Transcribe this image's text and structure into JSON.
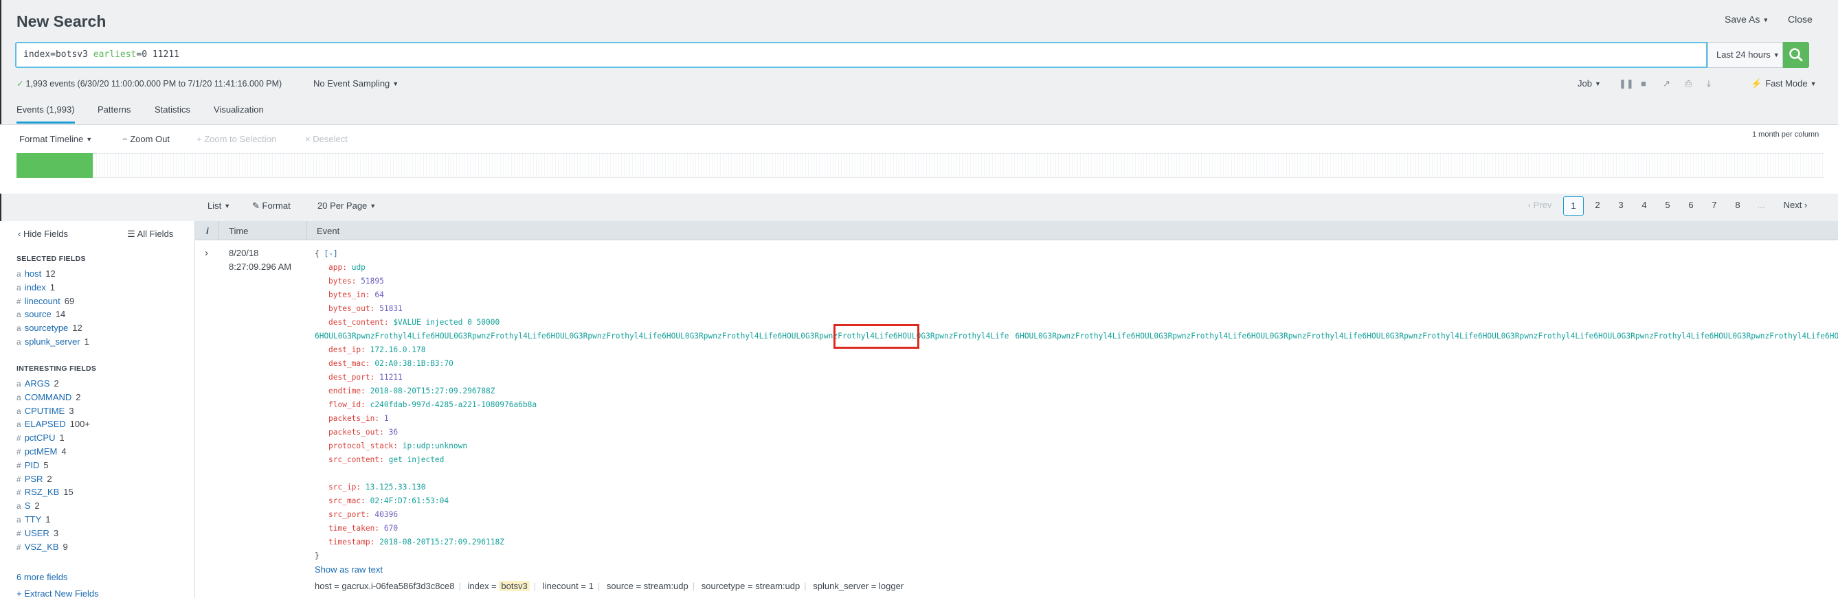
{
  "header": {
    "title": "New Search",
    "save_as": "Save As",
    "close": "Close"
  },
  "search": {
    "query_part1": "index=botsv3 ",
    "query_kw": "earliest",
    "query_part2": "=0 11211",
    "time_range": "Last 24 hours"
  },
  "status": {
    "events_summary": "1,993 events (6/30/20 11:00:00.000 PM to 7/1/20 11:41:16.000 PM)",
    "sampling": "No Event Sampling",
    "job": "Job",
    "mode": "Fast Mode"
  },
  "tabs": [
    {
      "label": "Events (1,993)"
    },
    {
      "label": "Patterns"
    },
    {
      "label": "Statistics"
    },
    {
      "label": "Visualization"
    }
  ],
  "timeline": {
    "format": "Format Timeline",
    "zoom_out": "Zoom Out",
    "zoom_selection": "Zoom to Selection",
    "deselect": "Deselect",
    "scale": "1 month per column"
  },
  "results": {
    "list": "List",
    "format": "Format",
    "per_page": "20 Per Page",
    "prev": "Prev",
    "pages": [
      "1",
      "2",
      "3",
      "4",
      "5",
      "6",
      "7",
      "8"
    ],
    "ellipsis": "...",
    "next": "Next"
  },
  "sidebar": {
    "hide_fields": "Hide Fields",
    "all_fields": "All Fields",
    "selected_heading": "SELECTED FIELDS",
    "selected": [
      {
        "type": "a",
        "name": "host",
        "count": "12"
      },
      {
        "type": "a",
        "name": "index",
        "count": "1"
      },
      {
        "type": "#",
        "name": "linecount",
        "count": "69"
      },
      {
        "type": "a",
        "name": "source",
        "count": "14"
      },
      {
        "type": "a",
        "name": "sourcetype",
        "count": "12"
      },
      {
        "type": "a",
        "name": "splunk_server",
        "count": "1"
      }
    ],
    "interesting_heading": "INTERESTING FIELDS",
    "interesting": [
      {
        "type": "a",
        "name": "ARGS",
        "count": "2"
      },
      {
        "type": "a",
        "name": "COMMAND",
        "count": "2"
      },
      {
        "type": "a",
        "name": "CPUTIME",
        "count": "3"
      },
      {
        "type": "a",
        "name": "ELAPSED",
        "count": "100+"
      },
      {
        "type": "#",
        "name": "pctCPU",
        "count": "1"
      },
      {
        "type": "#",
        "name": "pctMEM",
        "count": "4"
      },
      {
        "type": "#",
        "name": "PID",
        "count": "5"
      },
      {
        "type": "#",
        "name": "PSR",
        "count": "2"
      },
      {
        "type": "#",
        "name": "RSZ_KB",
        "count": "15"
      },
      {
        "type": "a",
        "name": "S",
        "count": "2"
      },
      {
        "type": "a",
        "name": "TTY",
        "count": "1"
      },
      {
        "type": "#",
        "name": "USER",
        "count": "3"
      },
      {
        "type": "#",
        "name": "VSZ_KB",
        "count": "9"
      }
    ],
    "more_fields": "6 more fields",
    "extract": "Extract New Fields"
  },
  "table": {
    "col_info": "i",
    "col_time": "Time",
    "col_event": "Event"
  },
  "event": {
    "date": "8/20/18",
    "time": "8:27:09.296 AM",
    "open_brace": "{",
    "collapse": "[-]",
    "app_k": "app:",
    "app_v": "udp",
    "bytes_k": "bytes:",
    "bytes_v": "51895",
    "bytes_in_k": "bytes_in:",
    "bytes_in_v": "64",
    "bytes_out_k": "bytes_out:",
    "bytes_out_v": "51831",
    "dest_content_k": "dest_content:",
    "dest_content_v": "$VALUE injected 0 50000",
    "payload_a": "6HOUL0G3RpwnzFrothyl4Life6HOUL0G3RpwnzFrothyl4Life6HOUL0G3RpwnzFrothyl4Life6HOUL0G3RpwnzFrothyl4Life6HOUL0G3RpwnzFrothyl4Life6HOUL0G3",
    "payload_b": "RpwnzFrothyl4Life",
    "payload_c": "6HOUL0G3RpwnzFrothyl4Life6HOUL0G3RpwnzFrothyl4Life6HOUL0G3RpwnzFrothyl4Life6HOUL0G3RpwnzFrothyl4Life6HOUL0G3RpwnzFrothyl4Life6HOUL0G3RpwnzFrothyl4Life6HOUL0G3RpwnzFrothyl4Life6HOUL0G3RpwnzFrothyl4Life6HOUL0G3Rpwnz",
    "dest_ip_k": "dest_ip:",
    "dest_ip_v": "172.16.0.178",
    "dest_mac_k": "dest_mac:",
    "dest_mac_v": "02:A0:38:1B:B3:70",
    "dest_port_k": "dest_port:",
    "dest_port_v": "11211",
    "endtime_k": "endtime:",
    "endtime_v": "2018-08-20T15:27:09.296788Z",
    "flow_id_k": "flow_id:",
    "flow_id_v": "c240fdab-997d-4285-a221-1080976a6b8a",
    "packets_in_k": "packets_in:",
    "packets_in_v": "1",
    "packets_out_k": "packets_out:",
    "packets_out_v": "36",
    "protocol_stack_k": "protocol_stack:",
    "protocol_stack_v": "ip:udp:unknown",
    "src_content_k": "src_content:",
    "src_content_v": "get injected",
    "src_ip_k": "src_ip:",
    "src_ip_v": "13.125.33.130",
    "src_mac_k": "src_mac:",
    "src_mac_v": "02:4F:D7:61:53:04",
    "src_port_k": "src_port:",
    "src_port_v": "40396",
    "time_taken_k": "time_taken:",
    "time_taken_v": "670",
    "timestamp_k": "timestamp:",
    "timestamp_v": "2018-08-20T15:27:09.296118Z",
    "close_brace": "}",
    "show_raw": "Show as raw text",
    "meta": {
      "host_k": "host =",
      "host_v": "gacrux.i-06fea586f3d3c8ce8",
      "index_k": "index =",
      "index_v": "botsv3",
      "linecount_k": "linecount =",
      "linecount_v": "1",
      "source_k": "source =",
      "source_v": "stream:udp",
      "sourcetype_k": "sourcetype =",
      "sourcetype_v": "stream:udp",
      "splunk_server_k": "splunk_server =",
      "splunk_server_v": "logger"
    }
  },
  "colors": {
    "accent": "#1a9cd4",
    "search_green": "#5cb85c",
    "highlight_red": "#dc2a1f",
    "key_red": "#d9413a",
    "value_teal": "#13a19a"
  }
}
